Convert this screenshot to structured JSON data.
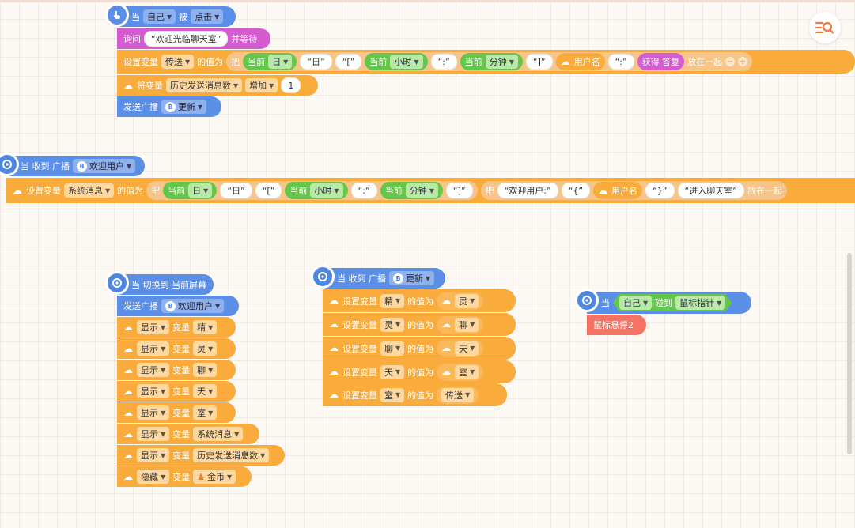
{
  "common": {
    "when": "当",
    "is": "被",
    "set_var": "设置变量",
    "value_is": "的值为",
    "take": "把",
    "current": "当前",
    "join": "放在一起",
    "var": "变量",
    "touch": "碰到",
    "when_recv": "当 收到 广播",
    "send_bc": "发送广播",
    "change_var": "将变量",
    "show": "显示",
    "hide": "隐藏",
    "bc_icon": "B"
  },
  "script1": {
    "self": "自己",
    "clicked": "点击",
    "ask": "询问",
    "ask_str": "欢迎光临聊天室",
    "and_wait": "并等待",
    "set_target": "传送",
    "units": [
      "日",
      "小时",
      "分钟"
    ],
    "strs": [
      "日",
      "[",
      ":",
      "]"
    ],
    "username": "用户名",
    "colon": ":",
    "answer": "获得 答复",
    "change_target": "历史发送消息数",
    "inc": "增加",
    "num": "1",
    "send": "更新"
  },
  "script2": {
    "bc": "欢迎用户",
    "set_target": "系统消息",
    "units": [
      "日",
      "小时",
      "分钟"
    ],
    "strs": [
      "日",
      "[",
      ":",
      "]",
      "欢迎用户:",
      "{",
      "}",
      "进入聊天室"
    ],
    "username": "用户名",
    "join_trunc": "放在一起"
  },
  "script3": {
    "title": "当 切换到 当前屏幕",
    "send": "欢迎用户",
    "rows": [
      {
        "act": "显示",
        "v": "精"
      },
      {
        "act": "显示",
        "v": "灵"
      },
      {
        "act": "显示",
        "v": "聊"
      },
      {
        "act": "显示",
        "v": "天"
      },
      {
        "act": "显示",
        "v": "室"
      },
      {
        "act": "显示",
        "v": "系统消息"
      },
      {
        "act": "显示",
        "v": "历史发送消息数"
      },
      {
        "act": "隐藏",
        "v": "金币"
      }
    ]
  },
  "script4": {
    "bc": "更新",
    "rows": [
      {
        "a": "精",
        "b": "灵"
      },
      {
        "a": "灵",
        "b": "聊"
      },
      {
        "a": "聊",
        "b": "天"
      },
      {
        "a": "天",
        "b": "室"
      },
      {
        "a": "室",
        "b": "传送"
      }
    ]
  },
  "script5": {
    "self": "自己",
    "target": "鼠标指针",
    "pen": "鼠标悬停2"
  },
  "colors": {
    "event": "#5b8ee6",
    "sensing": "#d55cd0",
    "variable": "#f9ab3c",
    "operator": "#64c64a",
    "pen": "#f47364",
    "background": "#fcf8f4"
  },
  "icons": {
    "pointer": "hand-pointer-icon",
    "broadcast": "broadcast-icon",
    "variable": "cloud-icon",
    "logo": "logo-icon"
  }
}
